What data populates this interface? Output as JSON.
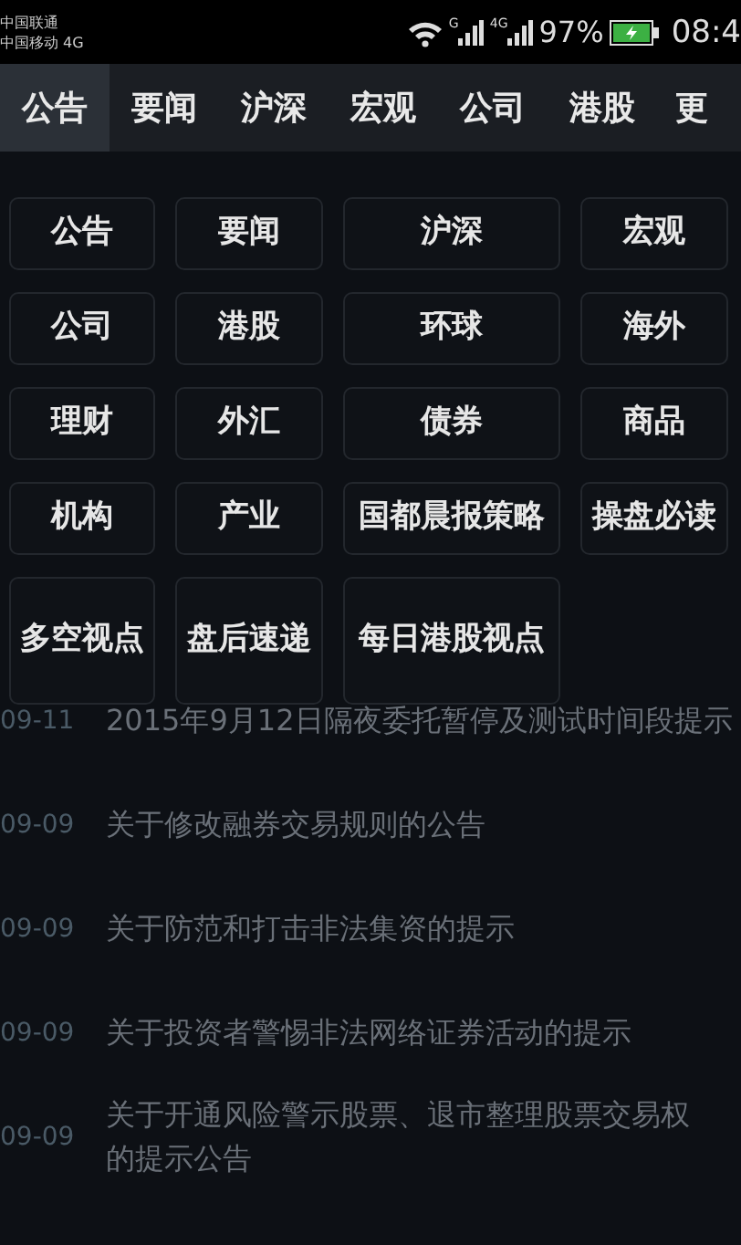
{
  "status_bar": {
    "carriers": [
      "中国联通",
      "中国移动 4G"
    ],
    "network_labels": [
      "G",
      "4G"
    ],
    "battery_percent": "97%",
    "time": "08:4"
  },
  "tabs": [
    {
      "label": "公告",
      "selected": true
    },
    {
      "label": "要闻",
      "selected": false
    },
    {
      "label": "沪深",
      "selected": false
    },
    {
      "label": "宏观",
      "selected": false
    },
    {
      "label": "公司",
      "selected": false
    },
    {
      "label": "港股",
      "selected": false
    },
    {
      "label": "更",
      "selected": false
    }
  ],
  "channel_grid": [
    {
      "label": "公告"
    },
    {
      "label": "要闻"
    },
    {
      "label": "沪深"
    },
    {
      "label": "宏观"
    },
    {
      "label": "公司"
    },
    {
      "label": "港股"
    },
    {
      "label": "环球"
    },
    {
      "label": "海外"
    },
    {
      "label": "理财"
    },
    {
      "label": "外汇"
    },
    {
      "label": "债券"
    },
    {
      "label": "商品"
    },
    {
      "label": "机构"
    },
    {
      "label": "产业"
    },
    {
      "label": "国都晨报策略"
    },
    {
      "label": "操盘必读"
    },
    {
      "label": "多空视点"
    },
    {
      "label": "盘后速递"
    },
    {
      "label": "每日港股视点"
    }
  ],
  "news_list": [
    {
      "date": "09-11",
      "title_lines": [
        "2015年9月12日隔夜委托暂停及测试时间段提示"
      ]
    },
    {
      "date": "09-09",
      "title_lines": [
        "关于修改融券交易规则的公告"
      ]
    },
    {
      "date": "09-09",
      "title_lines": [
        "关于防范和打击非法集资的提示"
      ]
    },
    {
      "date": "09-09",
      "title_lines": [
        "关于投资者警惕非法网络证券活动的提示"
      ]
    },
    {
      "date": "09-09",
      "title_lines": [
        "关于开通风险警示股票、退市整理股票交易权",
        "的提示公告"
      ]
    }
  ]
}
